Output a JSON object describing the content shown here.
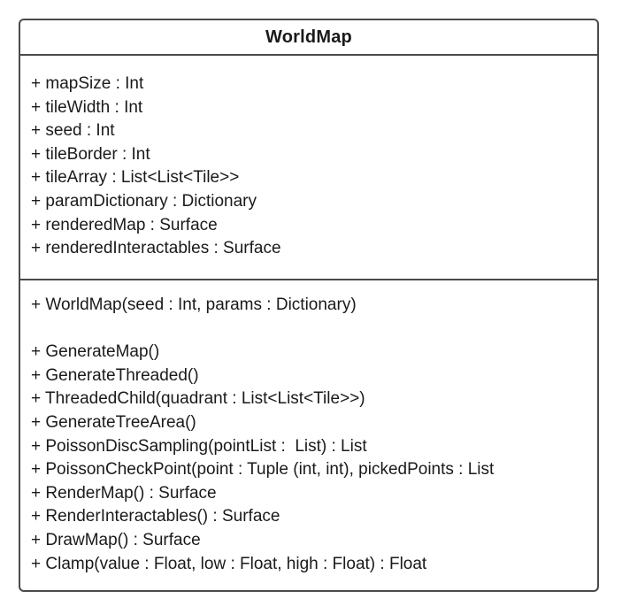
{
  "class_name": "WorldMap",
  "attributes": [
    "+ mapSize : Int",
    "+ tileWidth : Int",
    "+ seed : Int",
    "+ tileBorder : Int",
    "+ tileArray : List<List<Tile>>",
    "+ paramDictionary : Dictionary",
    "+ renderedMap : Surface",
    "+ renderedInteractables : Surface"
  ],
  "constructor": "+ WorldMap(seed : Int, params : Dictionary)",
  "methods": [
    "+ GenerateMap()",
    "+ GenerateThreaded()",
    "+ ThreadedChild(quadrant : List<List<Tile>>)",
    "+ GenerateTreeArea()",
    "+ PoissonDiscSampling(pointList :  List) : List",
    "+ PoissonCheckPoint(point : Tuple (int, int), pickedPoints : List",
    "+ RenderMap() : Surface",
    "+ RenderInteractables() : Surface",
    "+ DrawMap() : Surface",
    "+ Clamp(value : Float, low : Float, high : Float) : Float"
  ]
}
